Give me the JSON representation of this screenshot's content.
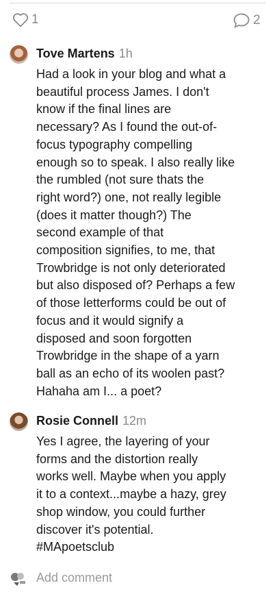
{
  "stats": {
    "likes_count": "1",
    "comments_count": "2",
    "like_icon": "heart-icon",
    "comment_icon": "speech-bubble-icon"
  },
  "comments": [
    {
      "author": "Tove Martens",
      "time": "1h",
      "lines": [
        "Had a look in your blog and what a",
        "beautiful process James. I don't",
        "know if the final lines are",
        "necessary? As I found the out-of-",
        "focus typography compelling",
        "enough so to speak. I also really like",
        "the rumbled (not sure thats the",
        "right word?) one, not really legible",
        "(does it matter though?) The",
        "second example of that",
        "composition signifies, to me, that",
        "Trowbridge is not only deteriorated",
        "but also disposed of? Perhaps a few",
        "of those letterforms could be out of",
        "focus and it would signify a",
        "disposed and soon forgotten",
        "Trowbridge in the shape of a yarn",
        "ball as an echo of its woolen past?",
        "Hahaha am I... a poet?"
      ]
    },
    {
      "author": "Rosie Connell",
      "time": "12m",
      "lines": [
        "Yes I agree, the layering of your",
        "forms and the distortion really",
        "works well. Maybe when you apply",
        "it to a context...maybe a hazy, grey",
        "shop window, you could further",
        "discover it's potential.",
        "#MApoetsclub"
      ]
    }
  ],
  "add_comment": {
    "placeholder": "Add comment"
  },
  "colors": {
    "muted": "#8a8a8a",
    "text": "#1a1a1a",
    "divider": "#d8d8d8"
  }
}
